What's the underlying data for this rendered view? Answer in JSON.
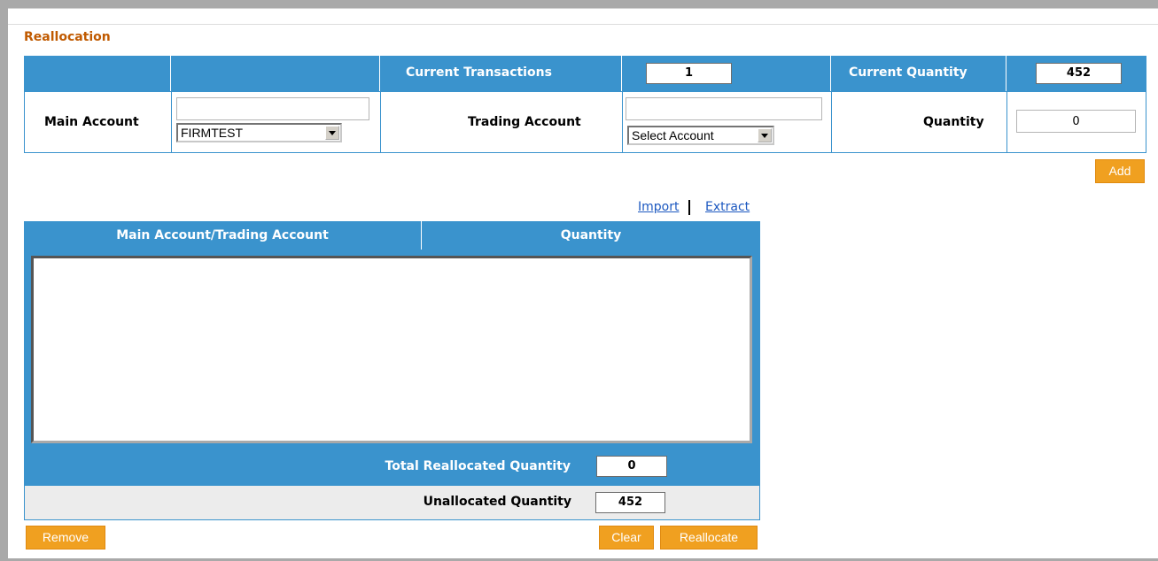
{
  "section_title": "Reallocation",
  "header": {
    "current_transactions_label": "Current Transactions",
    "current_transactions_value": "1",
    "current_quantity_label": "Current Quantity",
    "current_quantity_value": "452"
  },
  "form": {
    "main_account_label": "Main Account",
    "main_account_search_value": "",
    "main_account_selected": "FIRMTEST",
    "trading_account_label": "Trading Account",
    "trading_account_search_value": "",
    "trading_account_selected": "Select Account",
    "quantity_label": "Quantity",
    "quantity_value": "0",
    "add_label": "Add"
  },
  "links": {
    "import_label": "Import",
    "extract_label": "Extract"
  },
  "grid": {
    "columns": [
      "Main Account/Trading Account",
      "Quantity"
    ],
    "rows": []
  },
  "totals": {
    "total_reallocated_label": "Total Reallocated Quantity",
    "total_reallocated_value": "0",
    "unallocated_label": "Unallocated Quantity",
    "unallocated_value": "452"
  },
  "actions": {
    "remove_label": "Remove",
    "clear_label": "Clear",
    "reallocate_label": "Reallocate"
  },
  "colors": {
    "header_blue": "#3a93cd",
    "button_orange": "#f0a020",
    "title_orange": "#c05a00",
    "link_blue": "#1c58c0"
  }
}
